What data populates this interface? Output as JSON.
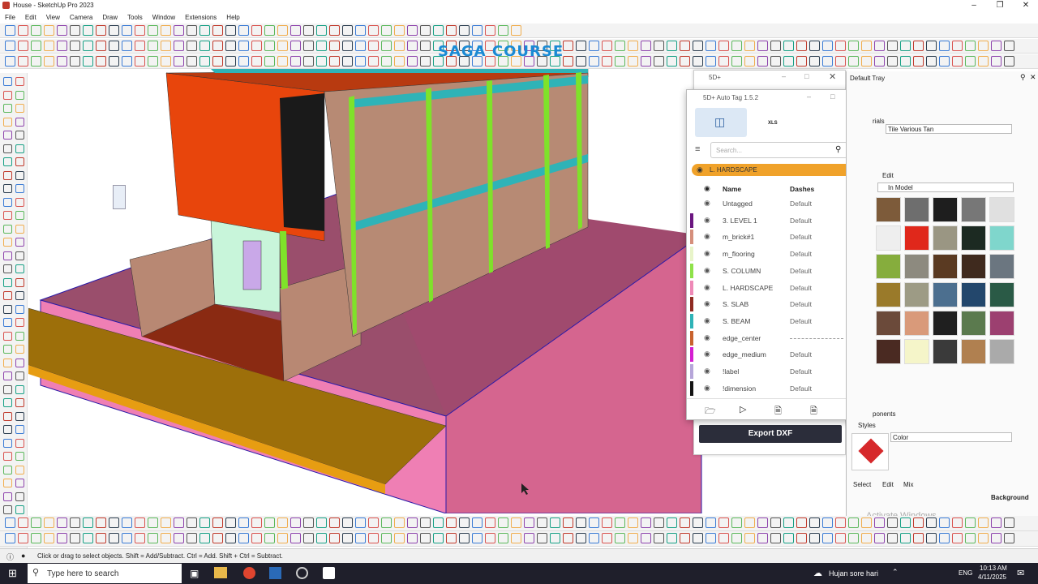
{
  "window": {
    "title": "House - SketchUp Pro 2023"
  },
  "menu": [
    "File",
    "Edit",
    "View",
    "Camera",
    "Draw",
    "Tools",
    "Window",
    "Extensions",
    "Help"
  ],
  "watermark": "SAGA COURSE",
  "sd_panel": {
    "title": "5D+"
  },
  "autotag": {
    "title": "5D+ Auto Tag 1.5.2",
    "tab_xls": "XLS",
    "search_placeholder": "Search...",
    "active_tag": "L. HARDSCAPE",
    "col_name": "Name",
    "col_dashes": "Dashes",
    "rows": [
      {
        "name": "Untagged",
        "dashes": "Default",
        "color": "#ffffff"
      },
      {
        "name": "3. LEVEL 1",
        "dashes": "Default",
        "color": "#6b1680"
      },
      {
        "name": "m_brick#1",
        "dashes": "Default",
        "color": "#d58f7c"
      },
      {
        "name": "m_flooring",
        "dashes": "Default",
        "color": "#e8f4c9"
      },
      {
        "name": "S. COLUMN",
        "dashes": "Default",
        "color": "#8fe24a"
      },
      {
        "name": "L. HARDSCAPE",
        "dashes": "Default",
        "color": "#ee89b7"
      },
      {
        "name": "S. SLAB",
        "dashes": "Default",
        "color": "#8f2b22"
      },
      {
        "name": "S. BEAM",
        "dashes": "Default",
        "color": "#2fb3b7"
      },
      {
        "name": "edge_center",
        "dashes": "",
        "color": "#c8622e"
      },
      {
        "name": "edge_medium",
        "dashes": "Default",
        "color": "#d41fd1"
      },
      {
        "name": "!label",
        "dashes": "Default",
        "color": "#b6a6d9"
      },
      {
        "name": "!dimension",
        "dashes": "Default",
        "color": "#141414"
      }
    ],
    "export_button": "Export DXF"
  },
  "tray": {
    "title": "Default Tray",
    "materials_label": "rials",
    "material_name": "Tile Various Tan",
    "edit_tab": "Edit",
    "in_model": "In Model",
    "components_label": "ponents",
    "styles_label": "Styles",
    "style_color": "Color",
    "select_tab": "Select",
    "edit_tab2": "Edit",
    "mix_tab": "Mix",
    "background_label": "Background",
    "swatches": [
      "#7d5b3a",
      "#6e6e6e",
      "#1e1e1e",
      "#777777",
      "#e0e0e0",
      "#eeeeee",
      "#e0281b",
      "#9a9683",
      "#1c2a22",
      "#7fd6cc",
      "#86ad3d",
      "#8d8a7f",
      "#5a3a22",
      "#3f2a1e",
      "#6b7680",
      "#9a7a2a",
      "#9d9b85",
      "#4c6f8f",
      "#23476c",
      "#2a5a46",
      "#6b4a3a",
      "#d99a7a",
      "#1f1f1f",
      "#5b7a4e",
      "#9c4070",
      "#4a2a22",
      "#f5f5c9",
      "#3a3a3a",
      "#b08050",
      "#aaaaaa",
      "#8a7a6a",
      "#777777",
      "#f2f2f2",
      "#ffffff",
      "#5a6a7a",
      "#888888"
    ]
  },
  "status": {
    "hint": "Click or drag to select objects. Shift = Add/Subtract. Ctrl = Add. Shift + Ctrl = Subtract."
  },
  "taskbar": {
    "search": "Type here to search",
    "weather": "Hujan sore hari",
    "lang": "ENG",
    "time": "10:13 AM",
    "date": "4/11/2025"
  },
  "activate": "Activate Windows"
}
